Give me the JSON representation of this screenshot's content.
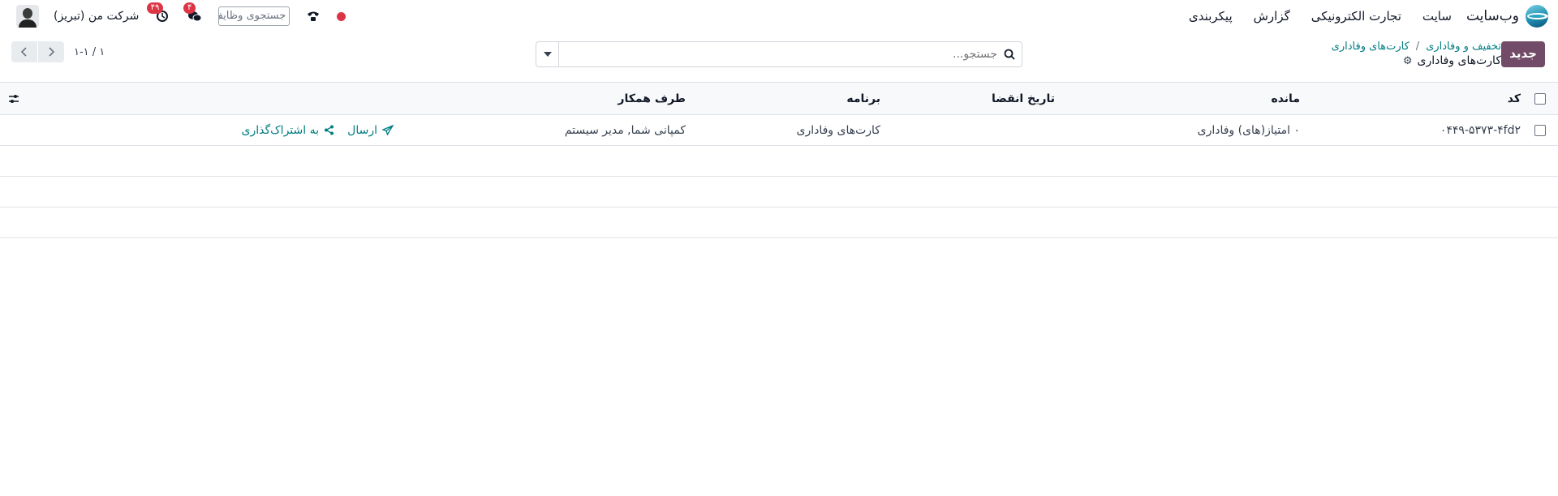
{
  "navbar": {
    "brand": "وب‌سایت",
    "menu": [
      "سایت",
      "تجارت الکترونیکی",
      "گزارش",
      "پیکربندی"
    ],
    "company": "شرکت من (تبریز)",
    "activity_count": "۴۹",
    "messages_count": "۴",
    "task_search_placeholder": "جستجوی وظایف"
  },
  "control": {
    "new_label": "جدید",
    "breadcrumb": [
      "تخفیف و وفاداری",
      "کارت‌های وفاداری"
    ],
    "title": "کارت‌های وفاداری",
    "search_placeholder": "جستجو...",
    "pager": "۱-۱ / ۱"
  },
  "table": {
    "headers": {
      "code": "کد",
      "balance": "مانده",
      "expiry": "تاریخ انقضا",
      "program": "برنامه",
      "partner": "طرف همکار"
    },
    "rows": [
      {
        "code": "۰۴۴۹-۵۳۷۳-۴fd۲",
        "balance": "۰ امتیاز(های) وفاداری",
        "expiry": "",
        "program": "کارت‌های وفاداری",
        "partner": "کمپانی شما, مدیر سیستم",
        "send": "ارسال",
        "share": "به اشتراک‌گذاری"
      }
    ]
  }
}
